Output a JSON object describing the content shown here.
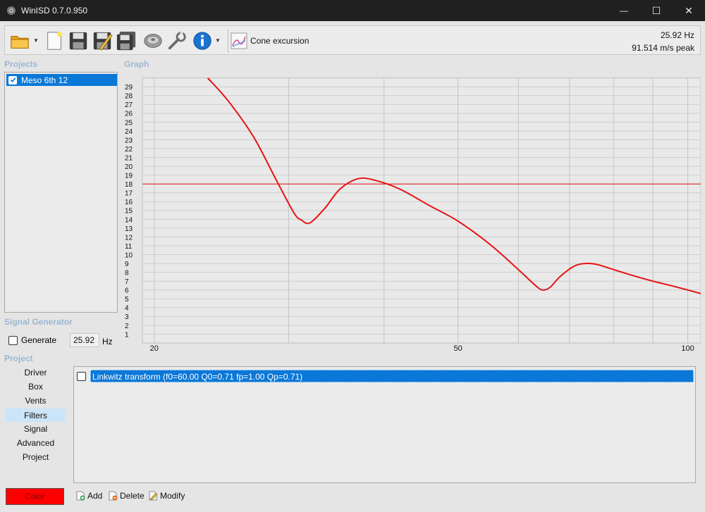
{
  "window": {
    "title": "WinISD 0.7.0.950",
    "controls": {
      "minimize": "—",
      "maximize": "☐",
      "close": "✕"
    }
  },
  "toolbar": {
    "buttons": [
      "open-folder-icon",
      "new-document-icon",
      "save-icon",
      "save-as-icon",
      "save-all-icon",
      "driver-icon",
      "tools-icon",
      "info-icon"
    ],
    "view_label": "Cone excursion",
    "readout_freq": "25.92 Hz",
    "readout_value": "91.514 m/s peak"
  },
  "projects": {
    "title": "Projects",
    "items": [
      {
        "label": "Meso 6th 12",
        "checked": true,
        "selected": true
      }
    ]
  },
  "graph": {
    "title": "Graph"
  },
  "signal_generator": {
    "title": "Signal Generator",
    "generate_label": "Generate",
    "generate_checked": false,
    "frequency_value": "25.92",
    "unit": "Hz"
  },
  "project": {
    "title": "Project",
    "nav": [
      {
        "label": "Driver",
        "active": false
      },
      {
        "label": "Box",
        "active": false
      },
      {
        "label": "Vents",
        "active": false
      },
      {
        "label": "Filters",
        "active": true
      },
      {
        "label": "Signal",
        "active": false
      },
      {
        "label": "Advanced",
        "active": false
      },
      {
        "label": "Project",
        "active": false
      }
    ]
  },
  "filters": {
    "items": [
      {
        "label": "Linkwitz transform (f0=60.00 Q0=0.71 fp=1.00 Qp=0.71)",
        "checked": false,
        "selected": true
      }
    ]
  },
  "actions": {
    "color_label": "Color",
    "add_label": "Add",
    "delete_label": "Delete",
    "modify_label": "Modify"
  },
  "colors": {
    "curve": "#e81010",
    "limit_line": "#e81010",
    "selection": "#0a78d7",
    "section_title": "#9bb7d4",
    "color_button": "#ff0000"
  },
  "chart_data": {
    "type": "line",
    "xscale": "log",
    "xlim": [
      19.3,
      104
    ],
    "ylim": [
      0,
      30
    ],
    "grid": true,
    "x_tick_labels": [
      "20",
      "50",
      "100"
    ],
    "y_tick_labels": [
      "1",
      "2",
      "3",
      "4",
      "5",
      "6",
      "7",
      "8",
      "9",
      "10",
      "11",
      "12",
      "13",
      "14",
      "15",
      "16",
      "17",
      "18",
      "19",
      "20",
      "21",
      "22",
      "23",
      "24",
      "25",
      "26",
      "27",
      "28",
      "29"
    ],
    "series": [
      {
        "x": [
          23.5,
          25,
          27,
          29,
          30.5,
          31.2,
          32,
          33.5,
          35,
          37,
          39,
          42,
          46,
          50,
          55,
          60,
          63,
          64.5,
          66,
          68,
          71,
          73.5,
          76,
          80,
          85,
          90,
          95,
          100,
          104
        ],
        "y": [
          30,
          27.4,
          23.3,
          18.2,
          14.7,
          13.9,
          13.6,
          15.3,
          17.4,
          18.6,
          18.4,
          17.4,
          15.5,
          13.8,
          11.2,
          8.3,
          6.6,
          6.0,
          6.3,
          7.5,
          8.7,
          9.0,
          8.9,
          8.3,
          7.6,
          7.0,
          6.5,
          6.0,
          5.6
        ]
      }
    ],
    "horizontal_line": 18
  }
}
